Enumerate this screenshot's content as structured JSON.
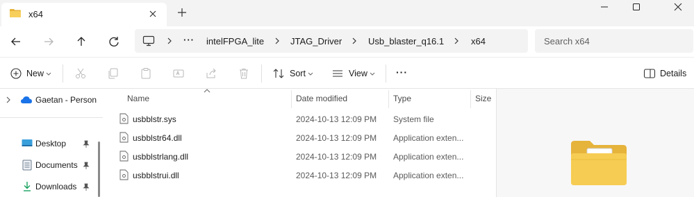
{
  "window": {
    "tab_title": "x64"
  },
  "breadcrumb": {
    "more": "···",
    "items": [
      "intelFPGA_lite",
      "JTAG_Driver",
      "Usb_blaster_q16.1",
      "x64"
    ]
  },
  "search": {
    "placeholder": "Search x64"
  },
  "toolbar": {
    "new_label": "New",
    "sort_label": "Sort",
    "view_label": "View",
    "more_label": "···",
    "details_label": "Details"
  },
  "nav": {
    "cloud_label": "Gaetan - Person",
    "items": [
      "Desktop",
      "Documents",
      "Downloads"
    ]
  },
  "columns": {
    "name": "Name",
    "date": "Date modified",
    "type": "Type",
    "size": "Size"
  },
  "files": [
    {
      "name": "usbblstr.sys",
      "date": "2024-10-13 12:09 PM",
      "type": "System file"
    },
    {
      "name": "usbblstr64.dll",
      "date": "2024-10-13 12:09 PM",
      "type": "Application exten..."
    },
    {
      "name": "usbblstrlang.dll",
      "date": "2024-10-13 12:09 PM",
      "type": "Application exten..."
    },
    {
      "name": "usbblstrui.dll",
      "date": "2024-10-13 12:09 PM",
      "type": "Application exten..."
    }
  ],
  "colors": {
    "folder": "#f2c341",
    "cloud": "#1a73e8",
    "accent": "#0067c0"
  }
}
